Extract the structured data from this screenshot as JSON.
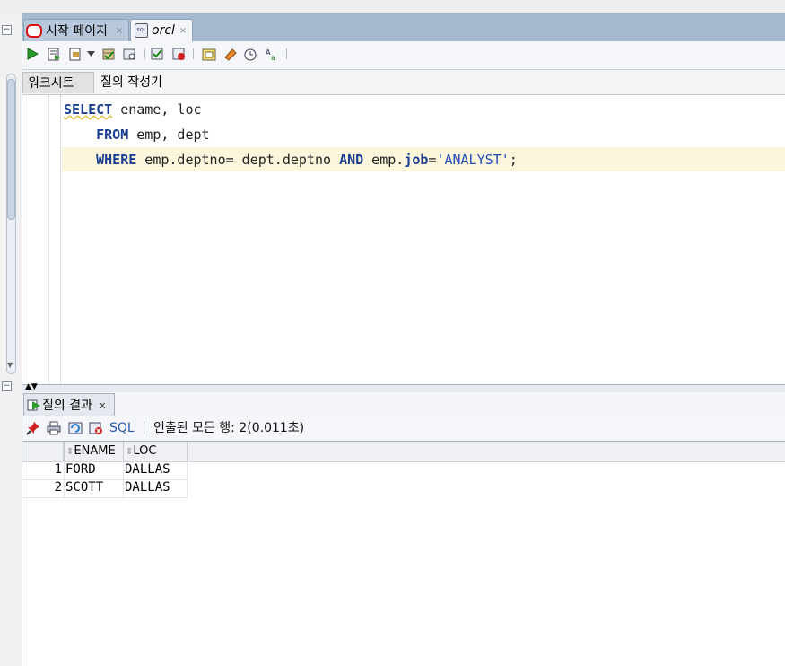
{
  "tabs": [
    {
      "label": "시작 페이지",
      "close": "×"
    },
    {
      "label": "orcl",
      "close": "×",
      "badge": "SQL"
    }
  ],
  "subtabs": [
    "워크시트",
    "질의 작성기"
  ],
  "editor": {
    "line1": {
      "kw1": "SELECT",
      "rest": " ename, loc"
    },
    "line2": {
      "kw1": "FROM",
      "rest": " emp, dept"
    },
    "line3": {
      "kw1": "WHERE",
      "mid": " emp.deptno= dept.deptno ",
      "kw2": "AND",
      "pre": " emp.",
      "kw3": "job",
      "eq": "=",
      "str": "'ANALYST'",
      "end": ";"
    }
  },
  "results": {
    "tab_label": "질의 결과",
    "tab_close": "x",
    "sql_label": "SQL",
    "status": "인출된 모든 행: 2(0.011초)",
    "columns": [
      "ENAME",
      "LOC"
    ],
    "rows": [
      {
        "num": "1",
        "ENAME": "FORD",
        "LOC": "DALLAS"
      },
      {
        "num": "2",
        "ENAME": "SCOTT",
        "LOC": "DALLAS"
      }
    ]
  },
  "colors": {
    "keyword": "#1c3f94",
    "string": "#2050b8",
    "tab_strip": "#a5b9d1",
    "current_line": "#fbf6dc"
  }
}
